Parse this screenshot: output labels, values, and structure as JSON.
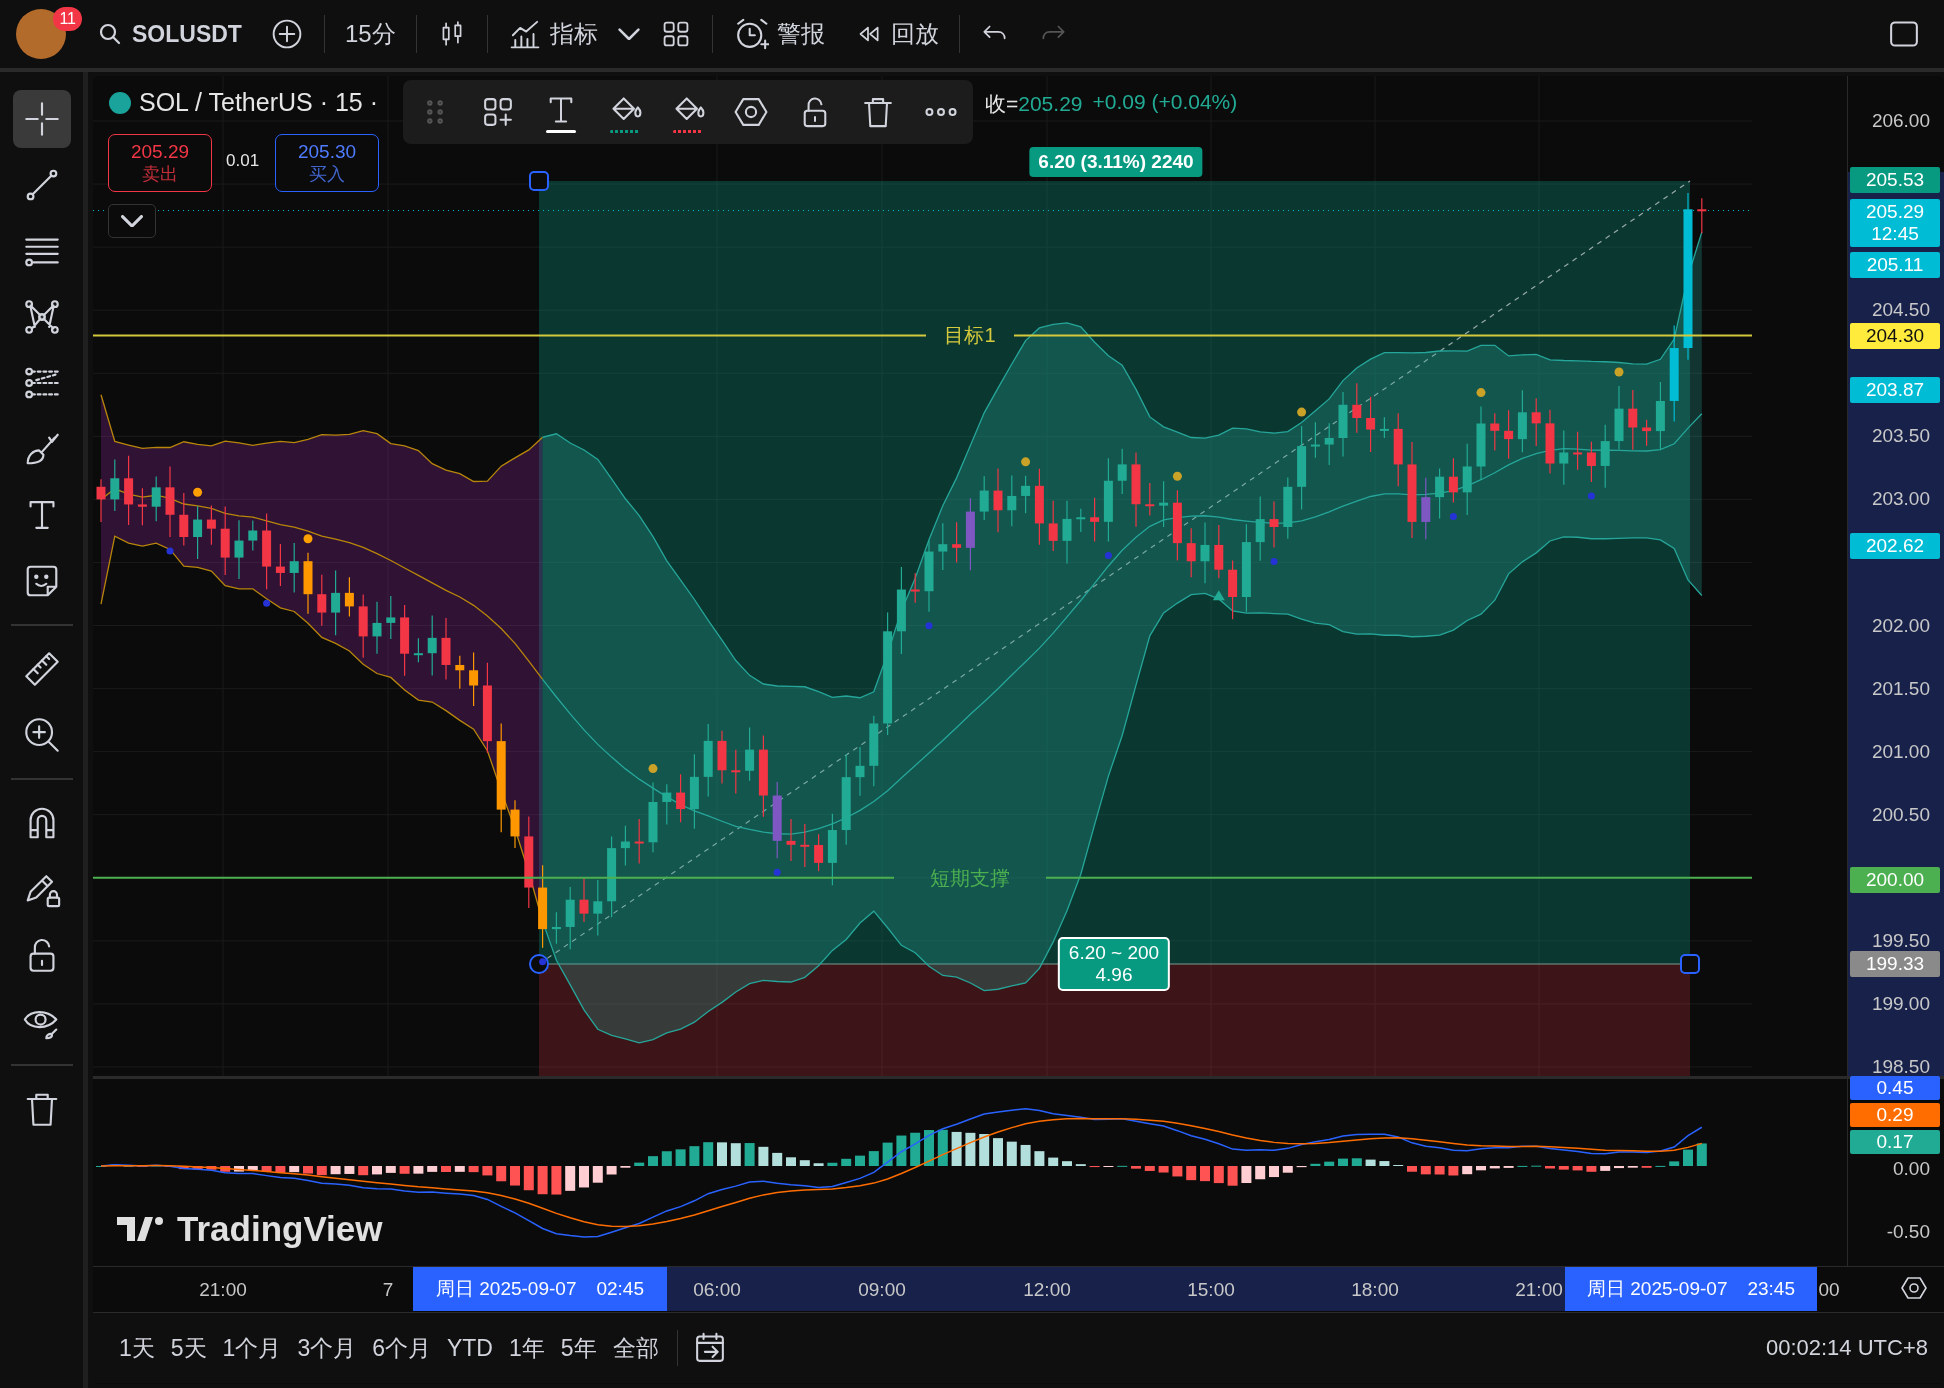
{
  "top_bar": {
    "notification_count": "11",
    "symbol": "SOLUSDT",
    "interval": "15分",
    "indicators": "指标",
    "alerts": "警报",
    "replay": "回放"
  },
  "toolbar_groups": [
    [
      {
        "kind": "crosshair",
        "selected": true
      },
      {
        "kind": "trend-line",
        "selected": false
      },
      {
        "kind": "horizontal-lines",
        "selected": false
      },
      {
        "kind": "pattern",
        "selected": false
      },
      {
        "kind": "fib",
        "selected": false
      },
      {
        "kind": "brush",
        "selected": false
      },
      {
        "kind": "text",
        "selected": false
      },
      {
        "kind": "sticker",
        "selected": false
      }
    ],
    [
      {
        "kind": "ruler",
        "selected": false
      },
      {
        "kind": "zoom",
        "selected": false
      }
    ],
    [
      {
        "kind": "magnet",
        "selected": false
      },
      {
        "kind": "drawing-lock",
        "selected": false
      },
      {
        "kind": "lock",
        "selected": false
      },
      {
        "kind": "eye",
        "selected": false
      }
    ],
    [
      {
        "kind": "trash",
        "selected": false
      }
    ]
  ],
  "legend": {
    "title": "SOL / TetherUS · 15 ·",
    "close_label": "收=",
    "close": "205.29",
    "change": "+0.09 (+0.04%)"
  },
  "order_panel": {
    "sell_price": "205.29",
    "sell_label": "卖出",
    "spread": "0.01",
    "buy_price": "205.30",
    "buy_label": "买入"
  },
  "levels": [
    {
      "label": "目标1",
      "color": "#d4c93c"
    },
    {
      "label": "短期支撑",
      "color": "#4caf50"
    }
  ],
  "position": {
    "target_label": "6.20 (3.11%) 2240",
    "range_label": "6.20 ~ 200",
    "amount_label": "4.96"
  },
  "price_axis": {
    "ticks": [
      "206.00",
      "204.50",
      "203.50",
      "203.00",
      "202.00",
      "201.50",
      "201.00",
      "200.50",
      "199.50",
      "199.00",
      "198.50"
    ],
    "badges": [
      {
        "lines": [
          "205.53"
        ],
        "color": "#089981"
      },
      {
        "lines": [
          "205.29",
          "12:45"
        ],
        "color": "#00bcd4"
      },
      {
        "lines": [
          "205.11"
        ],
        "color": "#00bcd4"
      },
      {
        "lines": [
          "204.30"
        ],
        "color": "#ffeb3b"
      },
      {
        "lines": [
          "203.87"
        ],
        "color": "#00bcd4"
      },
      {
        "lines": [
          "202.62"
        ],
        "color": "#00bcd4"
      },
      {
        "lines": [
          "200.00"
        ],
        "color": "#4caf50"
      },
      {
        "lines": [
          "199.33"
        ],
        "color": "#8a8a8a"
      }
    ]
  },
  "macd": {
    "logo": "TradingView",
    "ticks": [
      "0.00",
      "-0.50"
    ],
    "badges": [
      {
        "text": "0.45",
        "color": "#2962ff"
      },
      {
        "text": "0.29",
        "color": "#ff6d00"
      },
      {
        "text": "0.17",
        "color": "#22ab94"
      }
    ]
  },
  "time_axis": {
    "labels": [
      "21:00",
      "7",
      "06:00",
      "09:00",
      "12:00",
      "15:00",
      "18:00",
      "21:00",
      "00"
    ],
    "cursors": [
      {
        "day": "周日",
        "date": "2025-09-07",
        "time": "02:45"
      },
      {
        "day": "周日",
        "date": "2025-09-07",
        "time": "23:45"
      }
    ]
  },
  "bottom_bar": {
    "ranges": [
      "1天",
      "5天",
      "1个月",
      "3个月",
      "6个月",
      "YTD",
      "1年",
      "5年",
      "全部"
    ],
    "clock": "00:02:14 UTC+8"
  }
}
